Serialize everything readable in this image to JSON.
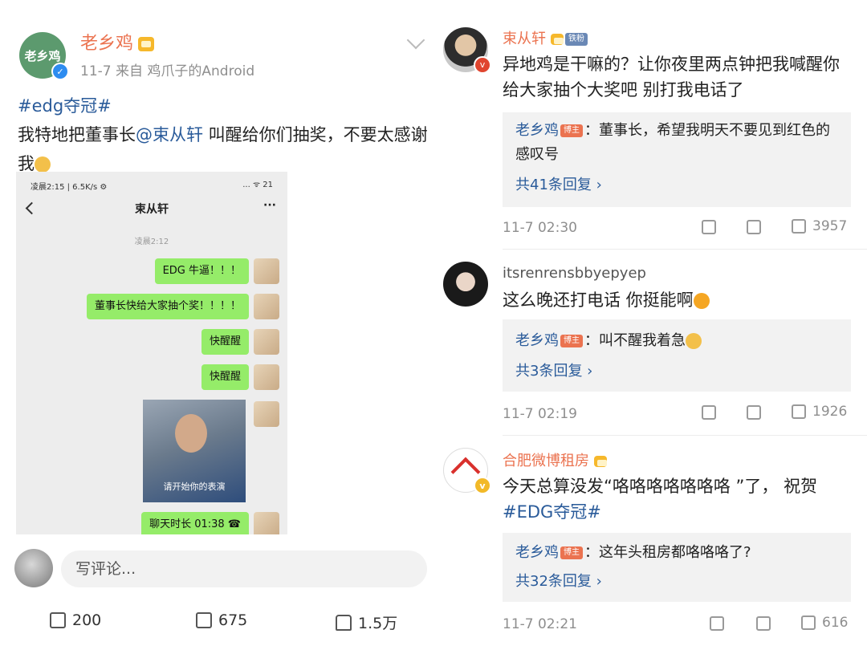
{
  "post": {
    "author": "老乡鸡",
    "avatar_text": "老乡鸡",
    "meta": "11-7  来自 鸡爪子的Android",
    "hashtag": "#edg夺冠#",
    "text_pre": "我特地把董事长",
    "mention": "@束从轩",
    "text_post": " 叫醒给你们抽奖，不要太感谢我"
  },
  "phone": {
    "status_left": "凌晨2:15 | 6.5K/s ⚙",
    "status_right": "... ᯤ 21",
    "chat_title": "束从轩",
    "more": "···",
    "time": "凌晨2:12",
    "bubbles": [
      "EDG 牛逼！！！",
      "董事长快给大家抽个奖！！！！",
      "快醒醒",
      "快醒醒"
    ],
    "meme_caption": "请开始你的表演",
    "call": "聊天时长 01:38 ☎"
  },
  "compose": {
    "placeholder": "写评论..."
  },
  "post_actions": {
    "repost": "200",
    "comment": "675",
    "like": "1.5万"
  },
  "comments": [
    {
      "author": "束从轩",
      "badge": "铁粉",
      "text": "异地鸡是干嘛的？让你夜里两点钟把我喊醒你给大家抽个大奖吧 别打我电话了",
      "reply_author": "老乡鸡",
      "reply_badge": "博主",
      "reply_text": "：董事长，希望我明天不要见到红色的感叹号",
      "reply_count": "共41条回复 ›",
      "time": "11-7 02:30",
      "likes": "3957"
    },
    {
      "author": "itsrenrensbbyepyep",
      "text": "这么晚还打电话 你挺能啊",
      "reply_author": "老乡鸡",
      "reply_badge": "博主",
      "reply_text": "：叫不醒我着急",
      "reply_count": "共3条回复 ›",
      "time": "11-7 02:19",
      "likes": "1926"
    },
    {
      "author": "合肥微博租房",
      "text": "今天总算没发“咯咯咯咯咯咯咯 ”了， 祝贺",
      "hashtag": "#EDG夺冠#",
      "reply_author": "老乡鸡",
      "reply_badge": "博主",
      "reply_text": "：这年头租房都咯咯咯了?",
      "reply_count": "共32条回复 ›",
      "time": "11-7 02:21",
      "likes": "616"
    }
  ],
  "colors": {
    "accent": "#eb7350",
    "link": "#2a5b9a",
    "bubble": "#95ec69"
  }
}
